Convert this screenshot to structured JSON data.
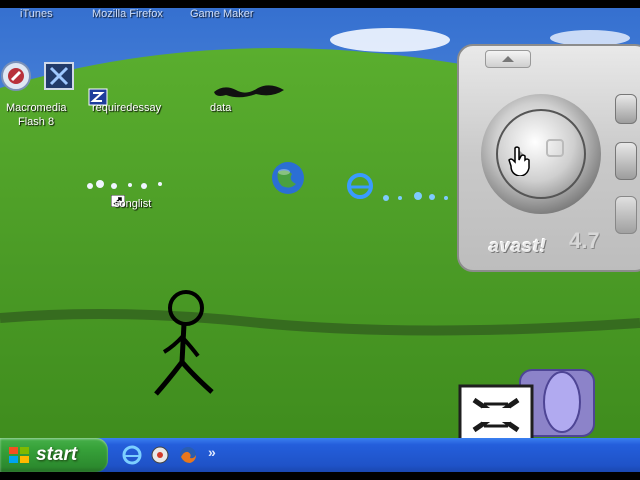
{
  "top_labels": [
    "iTunes",
    "Mozilla Firefox",
    "Game Maker"
  ],
  "desktop_icons": [
    {
      "label_line1": "Macromedia",
      "label_line2": "Flash 8"
    },
    {
      "label": "requiredessay"
    },
    {
      "label": "data"
    },
    {
      "label": "songlist"
    }
  ],
  "taskbar": {
    "start_label": "start",
    "overflow_label": "»"
  },
  "avast": {
    "brand": "avast!",
    "version": "4.7"
  },
  "colors": {
    "sky": "#3f7fd6",
    "grass": "#4a9a2a",
    "taskbar": "#245edb",
    "start": "#37a23a"
  },
  "icons": [
    "flash-icon",
    "x-app-icon",
    "document-icon",
    "shortcut-icon",
    "globe-icon",
    "ie-icon",
    "media-icon",
    "firefox-icon",
    "avast-icon"
  ]
}
